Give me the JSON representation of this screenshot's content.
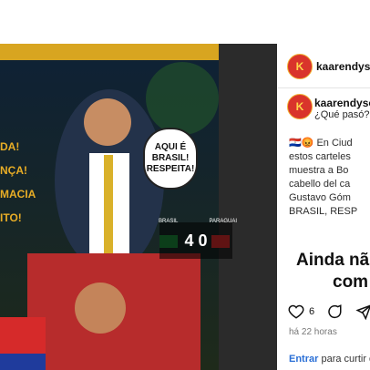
{
  "post": {
    "speech_bubble": [
      "AQUI É",
      "BRASIL!",
      "RESPEITA!"
    ],
    "score": "4 0",
    "team_left": "BRASIL",
    "team_right": "PARAGUAI",
    "banner_lines": [
      "DA!",
      "NÇA!",
      "MACIA",
      "ITO!"
    ]
  },
  "sidebar": {
    "username": "kaarendysoc",
    "avatar_letter": "K",
    "caption_user": "kaarendysoc",
    "caption": "¿Qué pasó?",
    "body": [
      "🇵🇾😡 En Ciud",
      "estos carteles",
      "muestra a Bo",
      "cabello del ca",
      "Gustavo Góm",
      "BRASIL, RESP"
    ],
    "notice_line1": "Ainda nã",
    "notice_line2": "com",
    "likes": "6",
    "time_ago": "há 22 horas",
    "login_link": "Entrar",
    "login_rest": " para curtir ou"
  }
}
